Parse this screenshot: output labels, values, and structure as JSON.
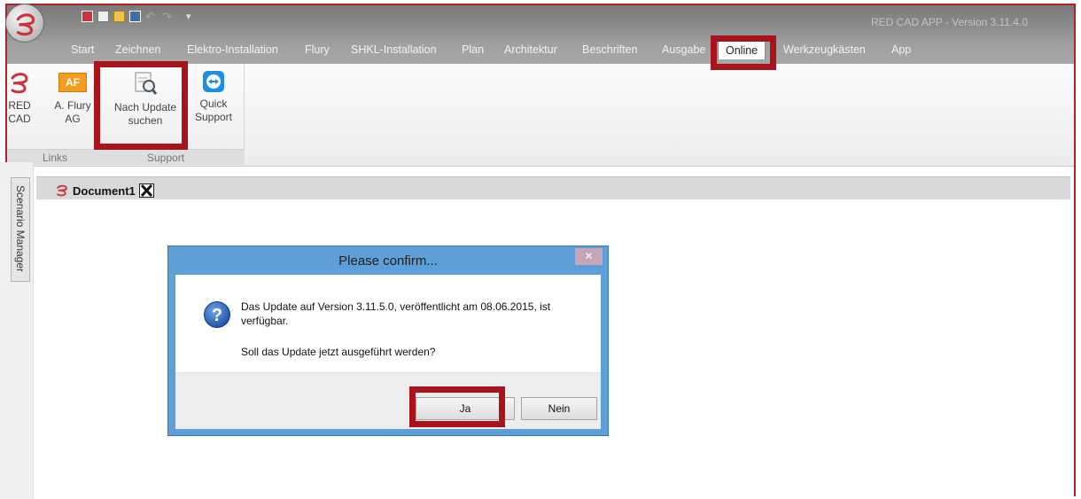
{
  "window": {
    "title": "RED CAD APP - Version 3.11.4.0"
  },
  "menu": {
    "tabs": [
      "Start",
      "Zeichnen",
      "Elektro-Installation",
      "Flury",
      "SHKL-Installation",
      "Plan",
      "Architektur",
      "Beschriften",
      "Ausgabe",
      "Online",
      "Werkzeugkästen",
      "App"
    ],
    "active_tab": "Online"
  },
  "ribbon": {
    "buttons": [
      {
        "line1": "RED",
        "line2": "CAD"
      },
      {
        "line1": "A. Flury",
        "line2": "AG",
        "logo_text": "AF"
      },
      {
        "line1": "Nach Update",
        "line2": "suchen"
      },
      {
        "line1": "Quick",
        "line2": "Support"
      }
    ],
    "groups": [
      "Links",
      "Support"
    ]
  },
  "side_panel": {
    "label": "Scenario Manager"
  },
  "document": {
    "tab_name": "Document1"
  },
  "dialog": {
    "title": "Please confirm...",
    "close_symbol": "✕",
    "icon_symbol": "?",
    "message": "Das Update auf Version 3.11.5.0, veröffentlicht am 08.06.2015, ist verfügbar.",
    "question": "Soll das Update jetzt ausgeführt werden?",
    "yes_label": "Ja",
    "no_label": "Nein"
  },
  "colors": {
    "highlight": "#a8141b",
    "brand_red": "#c9353f",
    "dialog_frame": "#5f9fd8"
  }
}
